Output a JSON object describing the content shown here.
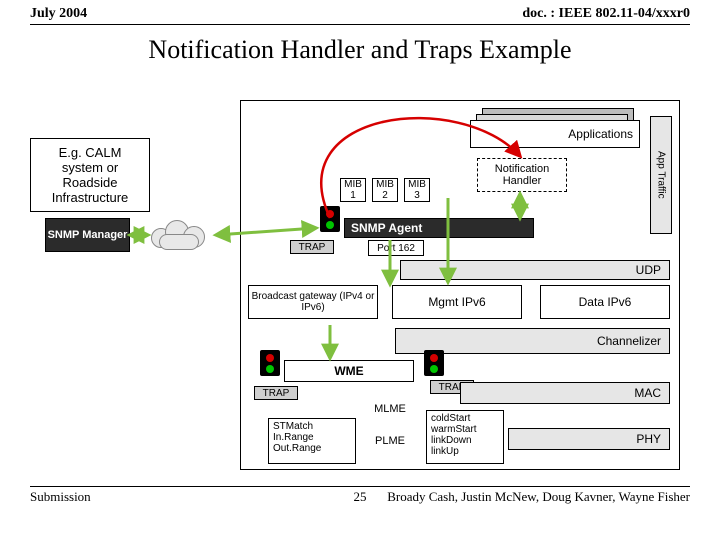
{
  "header": {
    "date": "July 2004",
    "docnum": "doc. : IEEE 802.11-04/xxxr0"
  },
  "title": "Notification Handler and Traps Example",
  "annotation": "E.g. CALM system or Roadside Infrastructure",
  "labels": {
    "applications": "Applications",
    "app_traffic": "App Traffic",
    "notif_handler": "Notification Handler",
    "snmp_manager": "SNMP Manager",
    "snmp_agent": "SNMP Agent",
    "port": "Port 162",
    "mib1": "MIB 1",
    "mib2": "MIB 2",
    "mib3": "MIB 3",
    "udp": "UDP",
    "bcast": "Broadcast gateway (IPv4 or IPv6)",
    "mgmt": "Mgmt IPv6",
    "data": "Data IPv6",
    "channelizer": "Channelizer",
    "wme": "WME",
    "mlme": "MLME",
    "plme": "PLME",
    "mac": "MAC",
    "phy": "PHY",
    "trap": "TRAP",
    "stmatch": "STMatch In.Range Out.Range",
    "cold": "coldStart warmStart linkDown linkUp"
  },
  "footer": {
    "left": "Submission",
    "page": "25",
    "right": "Broady Cash, Justin McNew, Doug Kavner, Wayne Fisher"
  }
}
